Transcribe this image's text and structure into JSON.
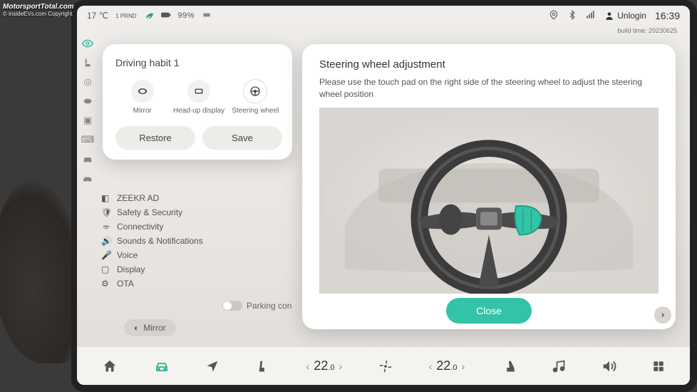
{
  "statusbar": {
    "temperature": "17 ℃",
    "drive_mode": "1 PRND",
    "battery_percent": "99%",
    "user_label": "Unlogin",
    "time": "16:39"
  },
  "build_time": "build time: 20230625",
  "sidebar": {
    "items": [
      {
        "name": "eye-icon",
        "active": true
      },
      {
        "name": "seat-icon"
      },
      {
        "name": "steering-icon"
      },
      {
        "name": "mirror-side-icon"
      },
      {
        "name": "car-front-icon"
      },
      {
        "name": "keyboard-icon"
      },
      {
        "name": "car-body-icon"
      },
      {
        "name": "car-side-icon"
      }
    ]
  },
  "bg_list": {
    "items": [
      {
        "icon": "ad-icon",
        "label": "ZEEKR AD"
      },
      {
        "icon": "shield-icon",
        "label": "Safety & Security"
      },
      {
        "icon": "wifi-icon",
        "label": "Connectivity"
      },
      {
        "icon": "speaker-icon",
        "label": "Sounds & Notifications"
      },
      {
        "icon": "mic-icon",
        "label": "Voice"
      },
      {
        "icon": "display-icon",
        "label": "Display"
      },
      {
        "icon": "gear-icon",
        "label": "OTA"
      }
    ],
    "toggle_label": "Parking con",
    "chip_label": "Mirror"
  },
  "popup_left": {
    "title": "Driving habit 1",
    "options": [
      {
        "icon": "mirror-icon",
        "label": "Mirror"
      },
      {
        "icon": "hud-icon",
        "label": "Head-up display"
      },
      {
        "icon": "steering-wheel-icon",
        "label": "Steering wheel",
        "selected": true
      }
    ],
    "restore_label": "Restore",
    "save_label": "Save"
  },
  "popup_right": {
    "title": "Steering wheel adjustment",
    "description": "Please use the touch pad on the right side of the steering wheel to adjust the steering wheel position",
    "close_label": "Close"
  },
  "dock": {
    "temp_left": "22",
    "temp_left_decimal": ".0",
    "temp_right": "22",
    "temp_right_decimal": ".0"
  },
  "watermark": {
    "main": "MotorsportTotal.com",
    "sub": "© insideEVs.com Copyright"
  },
  "colors": {
    "accent": "#33c3a6"
  }
}
